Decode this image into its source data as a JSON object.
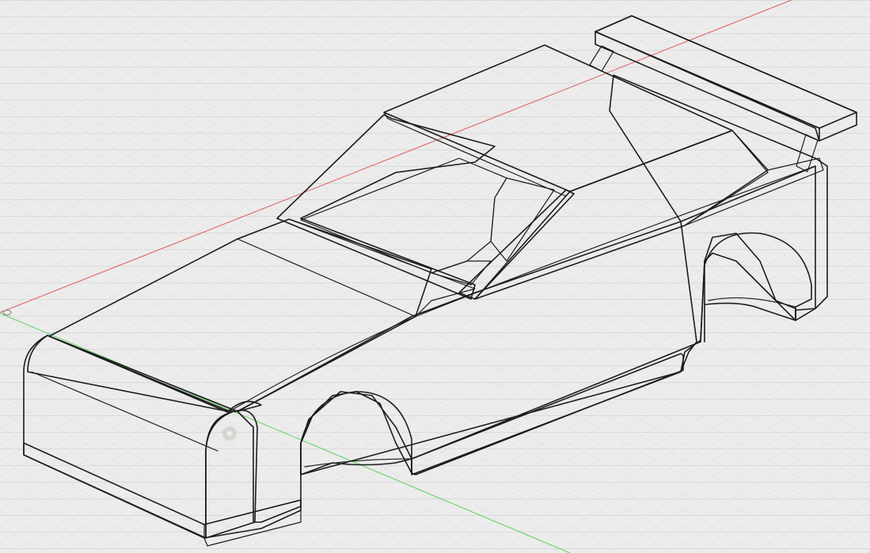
{
  "viewport": {
    "view_mode": "isometric",
    "grid_visible": true
  },
  "model": {
    "body_color": "#7d7c73",
    "body_dark": "#5f5e57",
    "body_light": "#9a9990",
    "edge_color": "#1c1c1c",
    "grid_color": "#c9c9c9",
    "grid_major_color": "#b7b7b7"
  },
  "axes": {
    "x_axis_color": "#e05b5b",
    "y_axis_color": "#5fcf5f"
  }
}
